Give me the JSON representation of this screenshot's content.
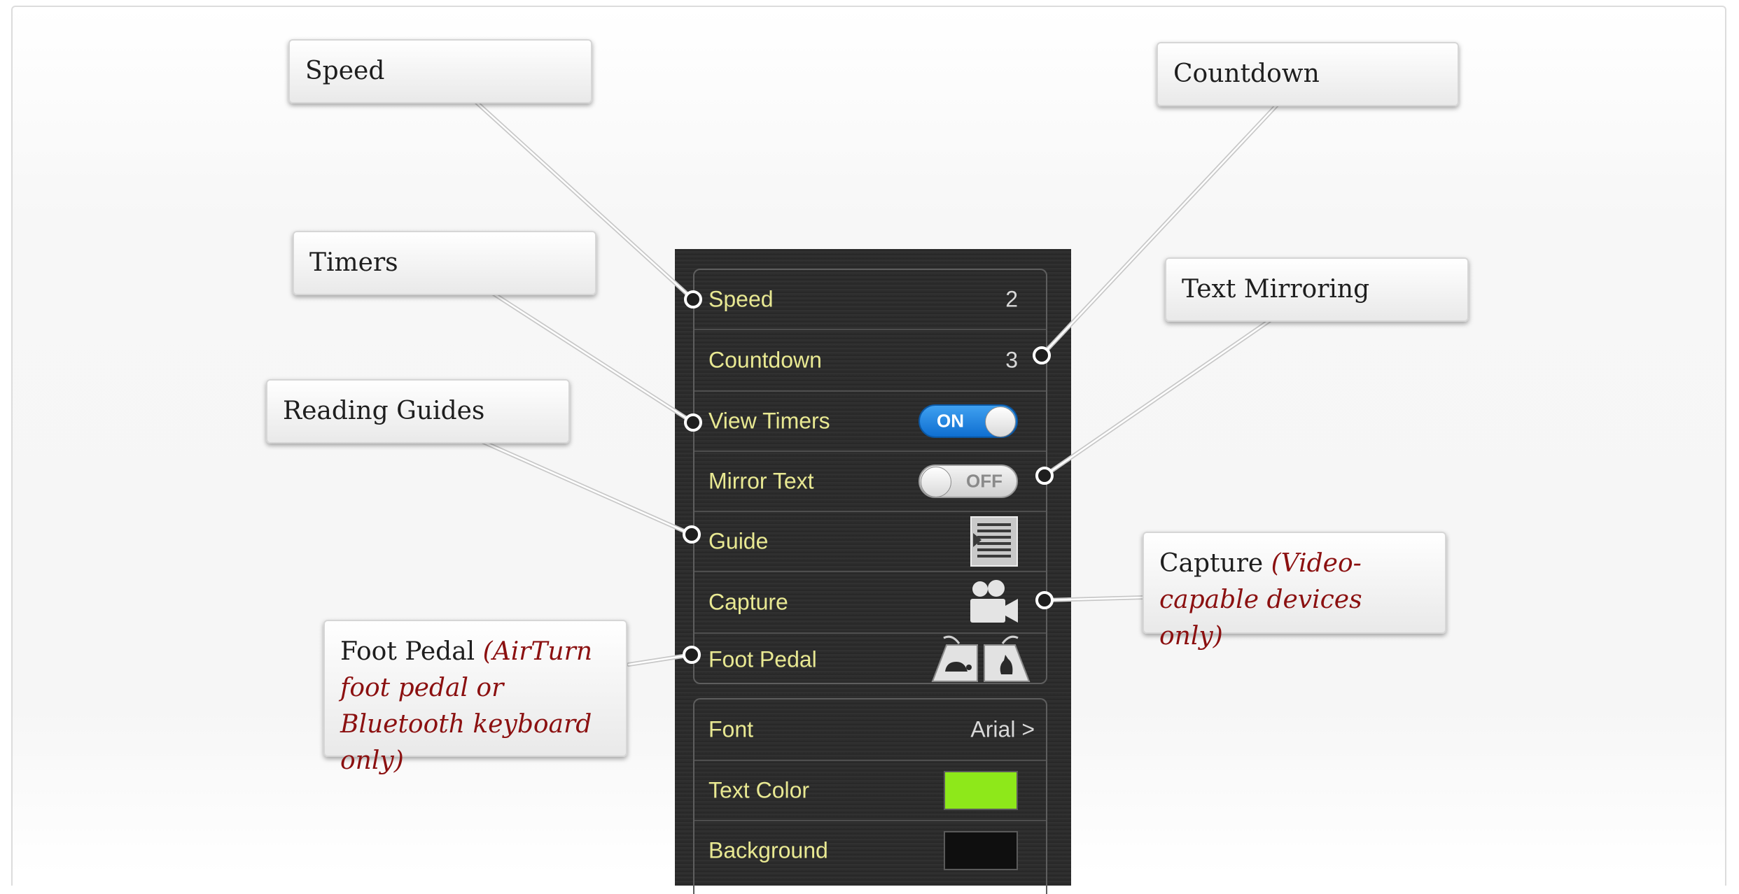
{
  "panel": {
    "group1": [
      {
        "label": "Speed",
        "value": "2"
      },
      {
        "label": "Countdown",
        "value": "3"
      },
      {
        "label": "View Timers",
        "toggle": "ON"
      },
      {
        "label": "Mirror Text",
        "toggle": "OFF"
      },
      {
        "label": "Guide",
        "icon": "reading-guide-icon"
      },
      {
        "label": "Capture",
        "icon": "video-camera-icon"
      },
      {
        "label": "Foot Pedal",
        "icon": "foot-pedal-icon"
      }
    ],
    "group2": [
      {
        "label": "Font",
        "value": "Arial >"
      },
      {
        "label": "Text Color",
        "swatch_color": "#8ee81a"
      },
      {
        "label": "Background",
        "swatch_color": "#0f0f0f"
      }
    ]
  },
  "callouts": {
    "speed": {
      "title": "Speed"
    },
    "countdown": {
      "title": "Countdown"
    },
    "timers": {
      "title": "Timers"
    },
    "text_mirroring": {
      "title": "Text Mirroring"
    },
    "reading_guides": {
      "title": "Reading Guides"
    },
    "capture": {
      "title": "Capture",
      "note": "(Video-capable devices only)"
    },
    "foot_pedal": {
      "title": "Foot Pedal",
      "note": "(AirTurn foot pedal or Bluetooth keyboard only)"
    }
  },
  "colors": {
    "label_text": "#e8e892",
    "note_text": "#8b1010",
    "toggle_on": "#1a7fe0",
    "text_color_swatch": "#8ee81a",
    "background_swatch": "#0f0f0f"
  }
}
